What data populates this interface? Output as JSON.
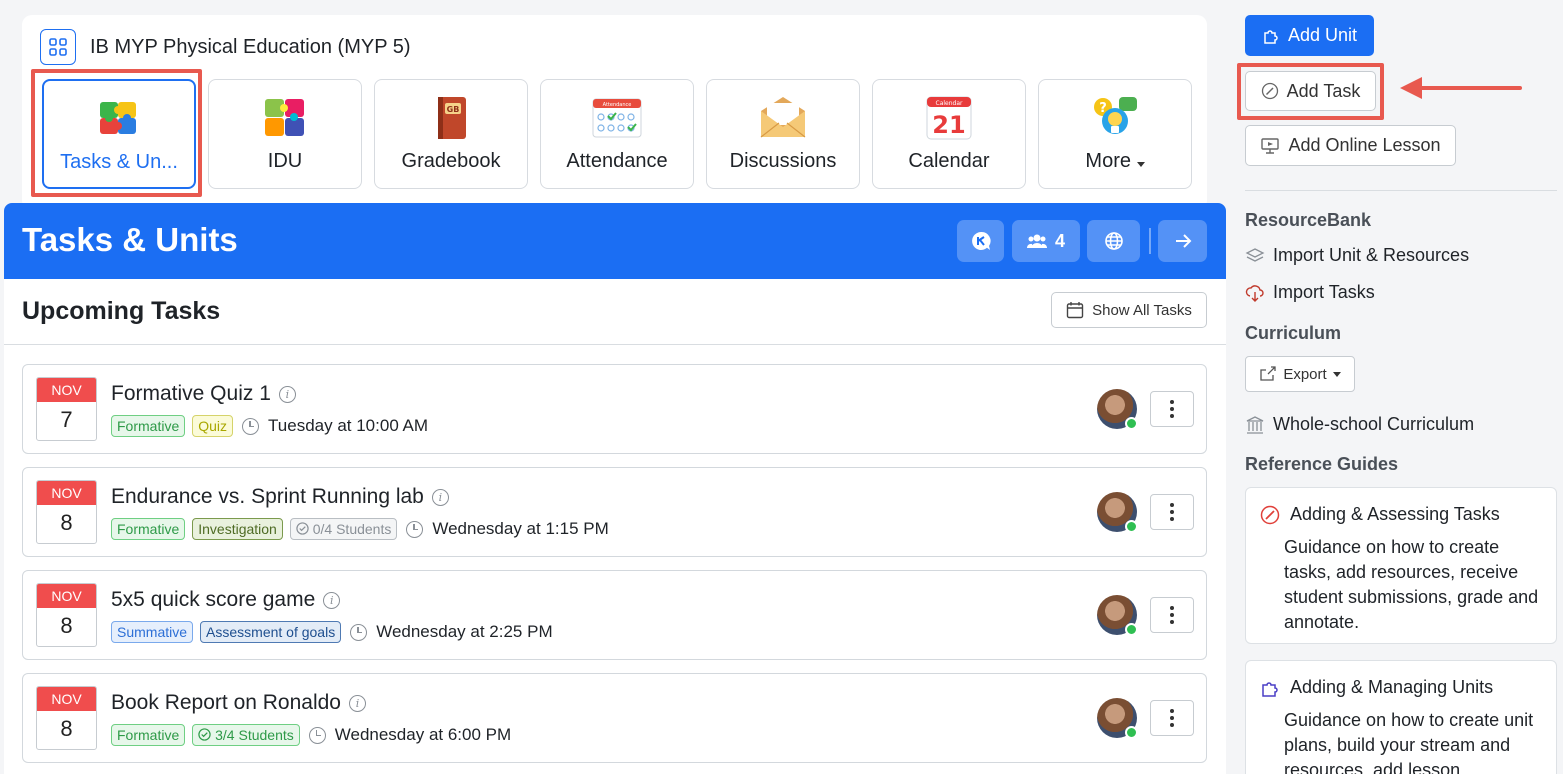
{
  "header": {
    "class_title": "IB MYP Physical Education (MYP 5)",
    "tiles": [
      {
        "label": "Tasks & Un...",
        "icon": "puzzle-icon",
        "active": true
      },
      {
        "label": "IDU",
        "icon": "puzzle-multicolor-icon"
      },
      {
        "label": "Gradebook",
        "icon": "gradebook-book-icon",
        "badge": "GB"
      },
      {
        "label": "Attendance",
        "icon": "attendance-calendar-icon",
        "badge": "Attendance"
      },
      {
        "label": "Discussions",
        "icon": "envelope-icon"
      },
      {
        "label": "Calendar",
        "icon": "calendar-icon",
        "badge": "Calendar",
        "day": "21"
      },
      {
        "label": "More",
        "icon": "lightbulb-chat-icon"
      }
    ]
  },
  "banner": {
    "title": "Tasks & Units",
    "member_count": "4"
  },
  "upcoming": {
    "title": "Upcoming Tasks",
    "show_all_label": "Show All Tasks",
    "tasks": [
      {
        "month": "NOV",
        "day": "7",
        "title": "Formative Quiz 1",
        "tags": [
          {
            "text": "Formative",
            "style": "green"
          },
          {
            "text": "Quiz",
            "style": "yellow"
          }
        ],
        "when": "Tuesday at 10:00 AM"
      },
      {
        "month": "NOV",
        "day": "8",
        "title": "Endurance vs. Sprint Running lab",
        "tags": [
          {
            "text": "Formative",
            "style": "green"
          },
          {
            "text": "Investigation",
            "style": "olive"
          },
          {
            "text": "0/4 Students",
            "style": "gray"
          }
        ],
        "when": "Wednesday at 1:15 PM"
      },
      {
        "month": "NOV",
        "day": "8",
        "title": "5x5 quick score game",
        "tags": [
          {
            "text": "Summative",
            "style": "blue"
          },
          {
            "text": "Assessment of goals",
            "style": "navy"
          }
        ],
        "when": "Wednesday at 2:25 PM"
      },
      {
        "month": "NOV",
        "day": "8",
        "title": "Book Report on Ronaldo",
        "tags": [
          {
            "text": "Formative",
            "style": "green"
          },
          {
            "text": "3/4 Students",
            "style": "green"
          }
        ],
        "when": "Wednesday at 6:00 PM"
      }
    ]
  },
  "sidebar": {
    "add_unit": "Add Unit",
    "add_task": "Add Task",
    "add_online_lesson": "Add Online Lesson",
    "resourcebank_title": "ResourceBank",
    "import_units": "Import Unit & Resources",
    "import_tasks": "Import Tasks",
    "curriculum_title": "Curriculum",
    "export_label": "Export",
    "whole_school": "Whole-school Curriculum",
    "guides_title": "Reference Guides",
    "guides": [
      {
        "title": "Adding & Assessing Tasks",
        "desc": "Guidance on how to create tasks, add resources, receive student submissions, grade and annotate."
      },
      {
        "title": "Adding & Managing Units",
        "desc": "Guidance on how to create unit plans, build your stream and resources, add lesson"
      }
    ]
  },
  "colors": {
    "primary": "#1b6ef3",
    "highlight": "#e8594f",
    "date_header": "#f04d4d",
    "online": "#2fbf52"
  }
}
